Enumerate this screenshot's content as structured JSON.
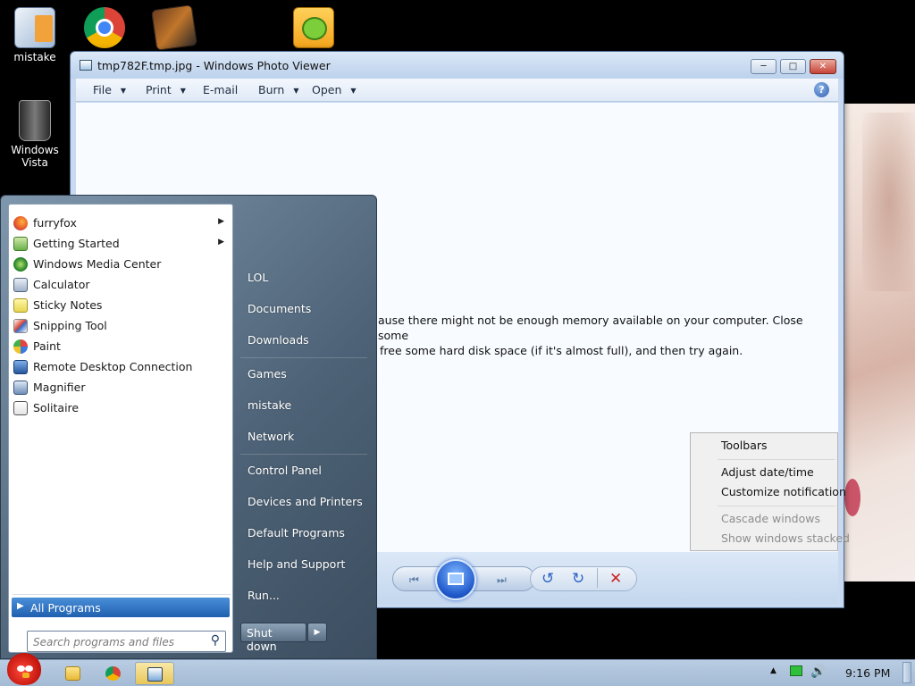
{
  "desktop": {
    "icons": [
      {
        "label": "mistake"
      },
      {
        "label": "Windows Vista"
      }
    ]
  },
  "viewer": {
    "title": "tmp782F.tmp.jpg - Windows Photo Viewer",
    "menu": [
      "File",
      "Print",
      "E-mail",
      "Burn",
      "Open"
    ],
    "message_line1": "ause there might not be enough memory available on your computer.  Close some",
    "message_line2": "free some hard disk space (if it's almost full), and then try again."
  },
  "context_menu": {
    "items": [
      "Toolbars",
      "Adjust date/time",
      "Customize notification",
      "Cascade windows",
      "Show windows stacked"
    ]
  },
  "start_menu": {
    "programs": [
      "furryfox",
      "Getting Started",
      "Windows Media Center",
      "Calculator",
      "Sticky Notes",
      "Snipping Tool",
      "Paint",
      "Remote Desktop Connection",
      "Magnifier",
      "Solitaire"
    ],
    "all_programs": "All Programs",
    "search_placeholder": "Search programs and files",
    "places": [
      "LOL",
      "Documents",
      "Downloads",
      "Games",
      "mistake",
      "Network",
      "Control Panel",
      "Devices and Printers",
      "Default Programs",
      "Help and Support",
      "Run..."
    ],
    "shutdown": "Shut down"
  },
  "taskbar": {
    "clock": "9:16 PM"
  },
  "colors": {
    "accent": "#1f5fb0",
    "taskbar": "#a4bbd5",
    "close_red": "#c7443a"
  }
}
